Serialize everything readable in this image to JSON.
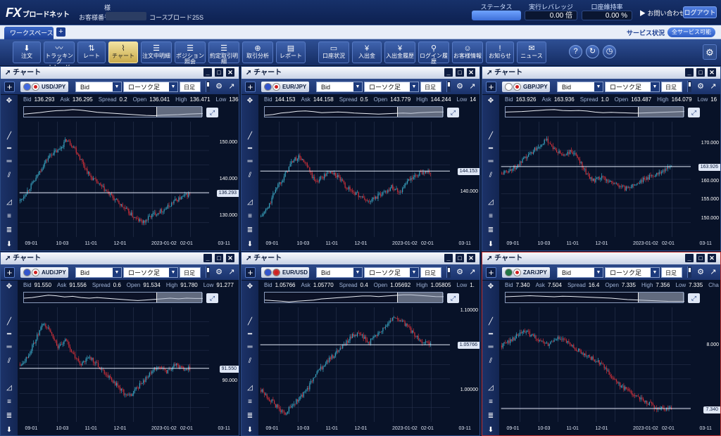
{
  "header": {
    "logo_main": "FX",
    "logo_sub": "ブロードネット",
    "honor": "様",
    "customer_label": "お客様番号",
    "course_label": "コース",
    "course_value": "ブロード25S",
    "status_label": "ステータス",
    "leverage_label": "実行レバレッジ",
    "leverage_value": "0.00",
    "leverage_unit": "倍",
    "margin_label": "口座維持率",
    "margin_value": "0.00 %",
    "contact": "お問い合わせ",
    "logout": "ログアウト"
  },
  "workspace": {
    "tab": "ワークスペース",
    "add": "+",
    "service_label": "サービス状況",
    "service_value": "全サービス可能"
  },
  "toolbar": [
    {
      "label": "注文",
      "icon": "⬇",
      "name": "order"
    },
    {
      "label": "トラッキング\nトレード",
      "icon": "〰",
      "name": "tracking-trade"
    },
    {
      "label": "レート",
      "icon": "⇅",
      "name": "rate"
    },
    {
      "label": "チャート",
      "icon": "⌇",
      "name": "chart",
      "active": true
    },
    {
      "label": "注文中明細",
      "icon": "☰",
      "name": "pending-orders"
    },
    {
      "label": "ポジション照会",
      "icon": "☰",
      "name": "positions"
    },
    {
      "label": "約定取引明細",
      "icon": "☰",
      "name": "executions"
    },
    {
      "label": "取引分析",
      "icon": "⊕",
      "name": "analysis"
    },
    {
      "label": "レポート",
      "icon": "▤",
      "name": "report"
    },
    {
      "label": "口座状況",
      "icon": "▭",
      "name": "account-status"
    },
    {
      "label": "入出金",
      "icon": "¥",
      "name": "deposit"
    },
    {
      "label": "入出金履歴",
      "icon": "¥",
      "name": "deposit-history"
    },
    {
      "label": "ログイン履歴",
      "icon": "⚲",
      "name": "login-history"
    },
    {
      "label": "お客様情報",
      "icon": "☺",
      "name": "customer-info"
    },
    {
      "label": "お知らせ",
      "icon": "!",
      "name": "notices"
    },
    {
      "label": "ニュース",
      "icon": "✉",
      "name": "news"
    }
  ],
  "panel_title": "チャート",
  "price_type": "Bid",
  "chart_type": "ローソク足",
  "timeframe": "日足",
  "quote_labels": {
    "bid": "Bid",
    "ask": "Ask",
    "spread": "Spread",
    "open": "Open",
    "high": "High",
    "low": "Low"
  },
  "panels": [
    {
      "pair": "USD/JPY",
      "bid": "136.293",
      "ask": "136.295",
      "spread": "0.2",
      "open": "136.041",
      "high": "136.471",
      "low": "136",
      "current": "136.293",
      "current_val": 136.293,
      "ymin": 124,
      "ymax": 156,
      "ticks": [
        {
          "t": "150.000",
          "v": 150
        },
        {
          "t": "140.000",
          "v": 140
        },
        {
          "t": "130.000",
          "v": 130
        }
      ],
      "path": [
        134,
        137,
        140,
        144,
        147,
        148,
        151,
        149,
        145,
        141,
        139,
        137,
        135,
        133,
        131,
        129,
        128,
        130,
        131,
        132,
        134,
        135,
        136
      ],
      "flag1": "#4169e1",
      "flag2": "#ffffff",
      "xlabels": [
        "09-01",
        "10-03",
        "11-01",
        "12-01",
        "2023-01-02",
        "02-01",
        "03-11"
      ]
    },
    {
      "pair": "EUR/JPY",
      "bid": "144.153",
      "ask": "144.158",
      "spread": "0.5",
      "open": "143.779",
      "high": "144.244",
      "low": "14",
      "current": "144.153",
      "current_val": 144.153,
      "ymin": 131,
      "ymax": 154,
      "ticks": [
        {
          "t": "140.000",
          "v": 140
        }
      ],
      "path": [
        135,
        137,
        141,
        143,
        146,
        147,
        145,
        142,
        143,
        144,
        143,
        141,
        140,
        139,
        138,
        139,
        140,
        141,
        140,
        142,
        143,
        144,
        144
      ],
      "flag1": "#3355cc",
      "flag2": "#ffffff",
      "xlabels": [
        "09-01",
        "10-03",
        "11-01",
        "12-01",
        "2023-01-02",
        "02-01",
        "03-11"
      ]
    },
    {
      "pair": "GBP/JPY",
      "bid": "163.926",
      "ask": "163.936",
      "spread": "1.0",
      "open": "163.487",
      "high": "164.079",
      "low": "16",
      "current": "163.926",
      "current_val": 163.926,
      "ymin": 145,
      "ymax": 176,
      "ticks": [
        {
          "t": "170.000",
          "v": 170
        },
        {
          "t": "160.000",
          "v": 160
        },
        {
          "t": "155.000",
          "v": 155
        },
        {
          "t": "150.000",
          "v": 150
        }
      ],
      "path": [
        162,
        163,
        164,
        166,
        168,
        170,
        171,
        168,
        167,
        168,
        166,
        162,
        160,
        161,
        160,
        159,
        158,
        159,
        160,
        161,
        162,
        163,
        164
      ],
      "flag1": "#ffffff",
      "flag2": "#ffffff",
      "xlabels": [
        "09-01",
        "10-03",
        "11-01",
        "12-01",
        "2023-01-02",
        "02-01",
        "03-11"
      ]
    },
    {
      "pair": "AUD/JPY",
      "bid": "91.550",
      "ask": "91.556",
      "spread": "0.6",
      "open": "91.534",
      "high": "91.780",
      "low": "91.277",
      "current": "91.550",
      "current_val": 91.55,
      "ymin": 85,
      "ymax": 99,
      "ticks": [
        {
          "t": "90.000",
          "v": 90
        }
      ],
      "path": [
        92,
        93,
        95,
        97,
        96,
        94,
        95,
        93,
        92,
        93,
        92,
        91,
        90,
        89,
        88,
        89,
        90,
        91,
        92,
        91,
        92,
        91.5,
        91.5
      ],
      "flag1": "#3355cc",
      "flag2": "#ffffff",
      "xlabels": [
        "09-01",
        "10-03",
        "11-01",
        "12-01",
        "2023-01-02",
        "02-01",
        "03-11"
      ]
    },
    {
      "pair": "EUR/USD",
      "bid": "1.05766",
      "ask": "1.05770",
      "spread": "0.4",
      "open": "1.05692",
      "high": "1.05805",
      "low": "1.",
      "current": "1.05766",
      "current_val": 1.05766,
      "ymin": 0.96,
      "ymax": 1.105,
      "ticks": [
        {
          "t": "1.10000",
          "v": 1.1
        },
        {
          "t": "1.00000",
          "v": 1.0
        }
      ],
      "path": [
        1.0,
        0.99,
        0.98,
        0.97,
        0.98,
        0.99,
        1.0,
        1.02,
        1.03,
        1.04,
        1.05,
        1.06,
        1.07,
        1.07,
        1.06,
        1.07,
        1.08,
        1.09,
        1.09,
        1.08,
        1.07,
        1.06,
        1.058
      ],
      "flag1": "#3355cc",
      "flag2": "#cc3333",
      "xlabels": [
        "09-01",
        "10-03",
        "11-01",
        "12-01",
        "2023-01-02",
        "02-01",
        "03-11"
      ]
    },
    {
      "pair": "ZAR/JPY",
      "bid": "7.340",
      "ask": "7.504",
      "spread": "16.4",
      "open": "7.335",
      "high": "7.356",
      "low": "7.335",
      "current": "7.340",
      "current_val": 7.34,
      "ymin": 7.2,
      "ymax": 8.4,
      "ticks": [
        {
          "t": "8.000",
          "v": 8.0
        }
      ],
      "path": [
        8.0,
        8.05,
        8.1,
        8.15,
        8.1,
        8.05,
        8.0,
        8.08,
        8.05,
        8.0,
        7.95,
        7.9,
        7.85,
        7.8,
        7.7,
        7.6,
        7.55,
        7.5,
        7.45,
        7.4,
        7.35,
        7.34,
        7.34
      ],
      "flag1": "#227744",
      "flag2": "#ffffff",
      "xlabels": [
        "09-01",
        "10-03",
        "11-01",
        "12-01",
        "2023-01-02",
        "02-01",
        "03-11"
      ],
      "extra": "Cha"
    }
  ]
}
